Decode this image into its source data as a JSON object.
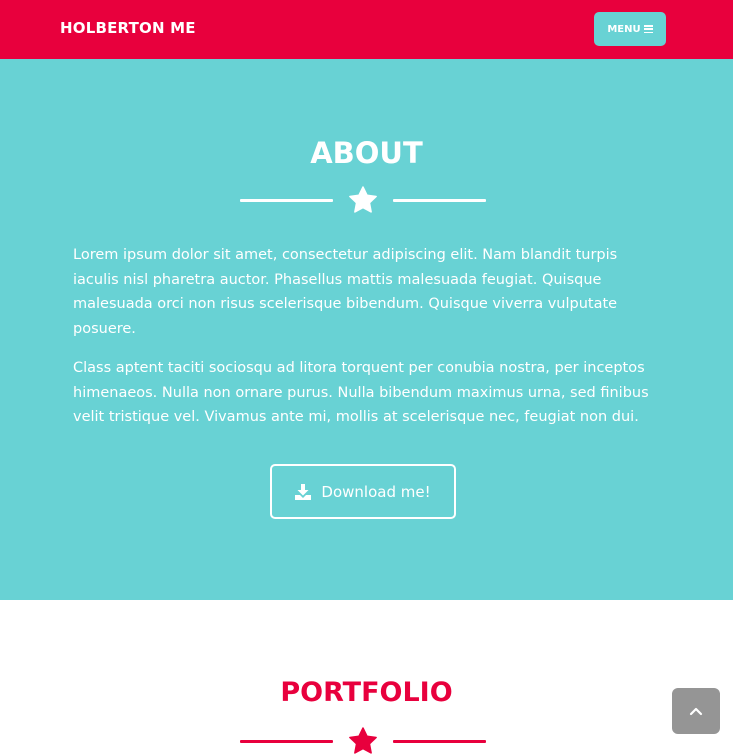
{
  "navbar": {
    "brand": "HOLBERTON ME",
    "menu_label": "MENU",
    "menu_icon": "hamburger-icon",
    "color": "#e8003d",
    "menu_color": "#68d2d4"
  },
  "about": {
    "title": "ABOUT",
    "divider_icon": "star-icon",
    "paragraphs": [
      "Lorem ipsum dolor sit amet, consectetur adipiscing elit. Nam blandit turpis iaculis nisl pharetra auctor. Phasellus mattis malesuada feugiat. Quisque malesuada orci non risus scelerisque bibendum. Quisque viverra vulputate posuere.",
      "Class aptent taciti sociosqu ad litora torquent per conubia nostra, per inceptos himenaeos. Nulla non ornare purus. Nulla bibendum maximus urna, sed finibus velit tristique vel. Vivamus ante mi, mollis at scelerisque nec, feugiat non dui."
    ],
    "download_label": "Download me!",
    "download_icon": "download-icon",
    "background": "#68d2d4"
  },
  "portfolio": {
    "title": "PORTFOLIO",
    "divider_icon": "star-icon",
    "color": "#e8003d"
  },
  "scroll_top": {
    "icon": "chevron-up-icon"
  }
}
